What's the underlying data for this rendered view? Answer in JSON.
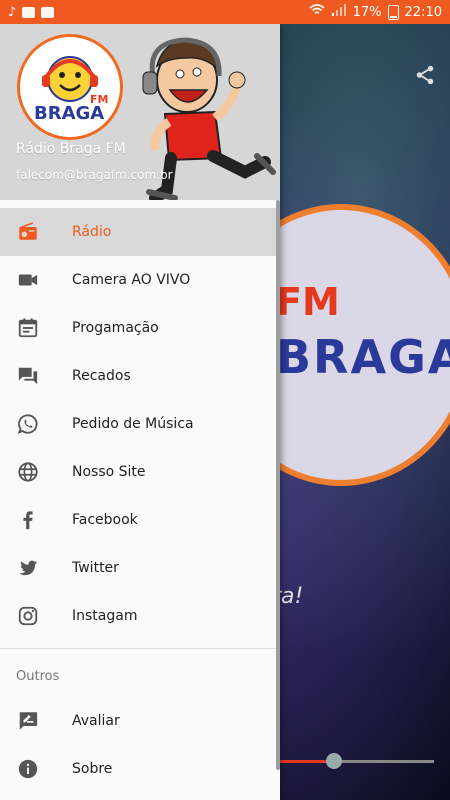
{
  "status_bar": {
    "battery": "17%",
    "time": "22:10",
    "icons": [
      "music-note-icon",
      "download-icon",
      "image-icon",
      "wifi-icon",
      "signal-icon",
      "battery-icon"
    ]
  },
  "drawer": {
    "title": "Rádio Braga FM",
    "email": "falecom@bragafm.com.br",
    "logo_text": "BRAGA",
    "logo_sub": "FM",
    "items": [
      {
        "label": "Rádio",
        "icon": "radio-icon",
        "active": true
      },
      {
        "label": "Camera AO VIVO",
        "icon": "video-camera-icon"
      },
      {
        "label": "Progamação",
        "icon": "calendar-icon"
      },
      {
        "label": "Recados",
        "icon": "chat-bubbles-icon"
      },
      {
        "label": "Pedido de Música",
        "icon": "whatsapp-icon"
      },
      {
        "label": "Nosso Site",
        "icon": "globe-icon"
      },
      {
        "label": "Facebook",
        "icon": "facebook-icon"
      },
      {
        "label": "Twitter",
        "icon": "twitter-icon"
      },
      {
        "label": "Instagam",
        "icon": "instagram-icon"
      }
    ],
    "section_other": "Outros",
    "other_items": [
      {
        "label": "Avaliar",
        "icon": "rate-review-icon"
      },
      {
        "label": "Sobre",
        "icon": "info-icon"
      }
    ]
  },
  "background": {
    "logo_text": "BRAGA",
    "logo_sub": "FM",
    "slogan_fragment": "ra!"
  },
  "colors": {
    "accent": "#ee5a1f",
    "drawer_bg": "#fafafa",
    "header_bg": "#d6d6d6"
  }
}
